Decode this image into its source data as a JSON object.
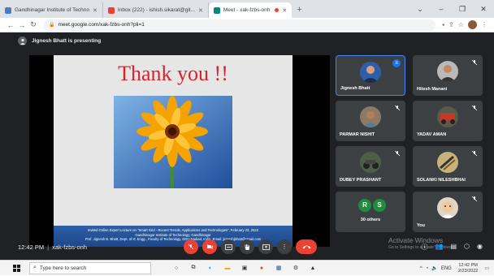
{
  "browser": {
    "tabs": [
      {
        "title": "Gandhinagar Institute of Techno",
        "fav_color": "#4a7bbf",
        "active": false
      },
      {
        "title": "Inbox (222) - ishish.sikarat@git...",
        "fav_color": "#ea4335",
        "active": false
      },
      {
        "title": "Meet - xak-fzbs-onh",
        "fav_color": "#00897b",
        "active": true
      }
    ],
    "new_tab": "+",
    "window_controls": [
      "⌄",
      "–",
      "❐",
      "✕"
    ],
    "url": "meet.google.com/xak-fzbs-onh?pli=1"
  },
  "meet": {
    "presenting_text": "Jignesh Bhatt is presenting",
    "slide": {
      "title": "Thank you !!",
      "footer_lines": [
        "Invited Online Expert Lecture on \"Smart Grid - Recent Trends, Applications and Technologies\", February 23, 2022",
        "Gandhinagar Institute of Technology, Gandhinagar",
        "Prof. Jignesh B. Bhatt, Dept. of IC Engg., Faculty of Technology, DDU Nadiad, India, Email: jigneshjbhatt@gmail.com"
      ]
    },
    "participants": [
      {
        "name": "Jignesh Bhatt",
        "active": true,
        "av_bg": "#2f5ea8"
      },
      {
        "name": "Hitesh Manani",
        "active": false,
        "av_bg": "#b9b9b9"
      },
      {
        "name": "PARMAR NISHIT",
        "active": false,
        "av_bg": "#8c7a66"
      },
      {
        "name": "YADAV AMAN",
        "active": false,
        "av_bg": "#5a5a4a"
      },
      {
        "name": "DUBEY PRASHANT",
        "active": false,
        "av_bg": "#4e5d45"
      },
      {
        "name": "SOLANKI NILESHBHAI",
        "active": false,
        "av_bg": "#c9b27a"
      }
    ],
    "others": {
      "label": "30 others",
      "initials": [
        "R",
        "S"
      ],
      "colors": [
        "#1e8e3e",
        "#1e8e3e"
      ]
    },
    "you": {
      "name": "You",
      "av_bg": "#e0d6c8"
    },
    "time": "12:42 PM",
    "meeting_code": "xak-fzbs-onh",
    "activate_title": "Activate Windows",
    "activate_sub": "Go to Settings to activate Windows."
  },
  "taskbar": {
    "search_placeholder": "Type here to search",
    "clock_time": "12:42 PM",
    "clock_date": "2/23/2022",
    "tray_lang": "ENG"
  }
}
